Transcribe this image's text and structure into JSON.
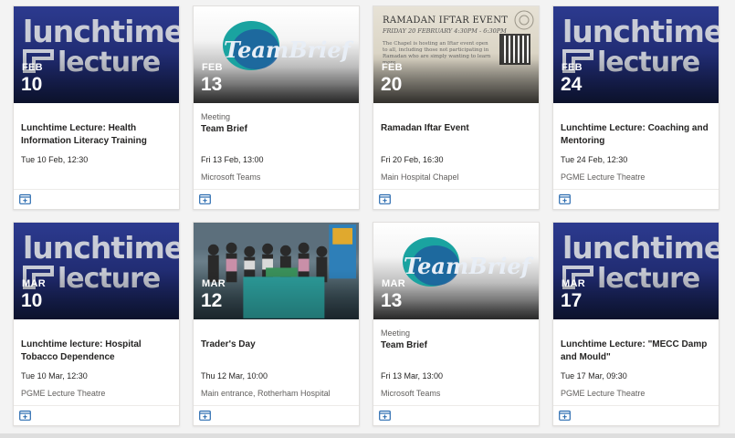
{
  "events": [
    {
      "hero": "lunchtime",
      "hero_text": [
        "lunchtime",
        "lecture"
      ],
      "month": "FEB",
      "day": "10",
      "tag": "",
      "title": "Lunchtime Lecture: Health Information Literacy Training",
      "when": "Tue 10 Feb, 12:30",
      "where": ""
    },
    {
      "hero": "teambrief",
      "hero_text": [
        "TeamBrief"
      ],
      "month": "FEB",
      "day": "13",
      "tag": "Meeting",
      "title": "Team Brief",
      "when": "Fri 13 Feb, 13:00",
      "where": "Microsoft Teams"
    },
    {
      "hero": "ramadan",
      "hero_text": [
        "RAMADAN IFTAR EVENT",
        "FRIDAY 20 FEBRUARY 4:30PM - 6:30PM",
        "The Chapel is hosting an Iftar event open to all, including those not participating in Ramadan who are simply wanting to learn more."
      ],
      "month": "FEB",
      "day": "20",
      "tag": "",
      "title": "Ramadan Iftar Event",
      "when": "Fri 20 Feb, 16:30",
      "where": "Main Hospital Chapel"
    },
    {
      "hero": "lunchtime",
      "hero_text": [
        "lunchtime",
        "lecture"
      ],
      "month": "FEB",
      "day": "24",
      "tag": "",
      "title": "Lunchtime Lecture: Coaching and Mentoring",
      "when": "Tue 24 Feb, 12:30",
      "where": "PGME Lecture Theatre"
    },
    {
      "hero": "lunchtime",
      "hero_text": [
        "lunchtime",
        "lecture"
      ],
      "month": "MAR",
      "day": "10",
      "tag": "",
      "title": "Lunchtime lecture: Hospital Tobacco Dependence",
      "when": "Tue 10 Mar, 12:30",
      "where": "PGME Lecture Theatre"
    },
    {
      "hero": "trader",
      "hero_text": [],
      "month": "MAR",
      "day": "12",
      "tag": "",
      "title": "Trader's Day",
      "when": "Thu 12 Mar, 10:00",
      "where": "Main entrance, Rotherham Hospital"
    },
    {
      "hero": "teambrief",
      "hero_text": [
        "TeamBrief"
      ],
      "month": "MAR",
      "day": "13",
      "tag": "Meeting",
      "title": "Team Brief",
      "when": "Fri 13 Mar, 13:00",
      "where": "Microsoft Teams"
    },
    {
      "hero": "lunchtime",
      "hero_text": [
        "lunchtime",
        "lecture"
      ],
      "month": "MAR",
      "day": "17",
      "tag": "",
      "title": "Lunchtime Lecture: \"MECC Damp and Mould\"",
      "when": "Tue 17 Mar, 09:30",
      "where": "PGME Lecture Theatre"
    }
  ],
  "icons": {
    "add_to_calendar": "calendar-add-icon"
  },
  "colors": {
    "lunchtime_bg": "#1f2a6e",
    "teambrief_blue": "#1e5f9e",
    "teambrief_teal": "#1aa3a0",
    "calendar_icon": "#2b6cb0"
  }
}
